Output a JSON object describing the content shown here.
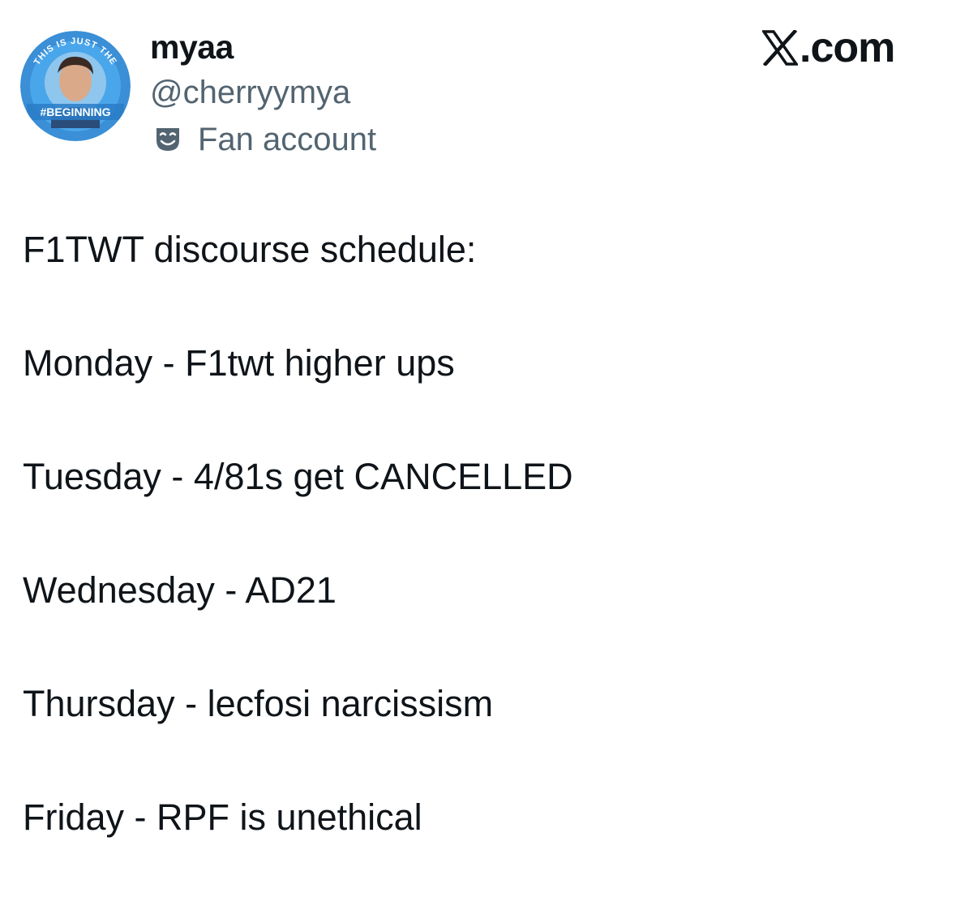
{
  "author": {
    "display_name": "myaa",
    "handle": "@cherryymya",
    "account_label": "Fan account",
    "account_label_icon": "theater-masks-icon",
    "avatar": {
      "ring_text_top": "THIS IS JUST THE",
      "ring_text_bottom": "#BEGINNING",
      "ring_color": "#1d9bf0"
    }
  },
  "brand": {
    "logo_icon": "x-logo-icon",
    "label": ".com"
  },
  "post": {
    "lines": [
      "F1TWT discourse schedule:",
      "Monday - F1twt higher ups",
      "Tuesday - 4/81s get CANCELLED",
      "Wednesday - AD21",
      "Thursday - lecfosi narcissism",
      "Friday - RPF is unethical"
    ]
  },
  "colors": {
    "text": "#0f1419",
    "secondary": "#536471",
    "accent": "#1d9bf0"
  }
}
